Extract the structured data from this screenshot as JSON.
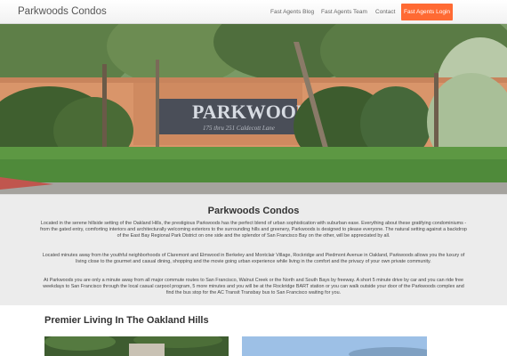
{
  "navbar": {
    "brand": "Parkwoods Condos",
    "links": [
      "Fast Agents Blog",
      "Fast Agents Team",
      "Contact"
    ],
    "login": "Fast Agents Login"
  },
  "hero": {
    "sign_text": "PARKWOOD",
    "sign_subtext": "175 thru 251 Caldecott Lane"
  },
  "intro": {
    "title": "Parkwoods Condos",
    "paragraph1": "Located in the serene hillside setting of the Oakland Hills, the prestigious Parkwoods has the perfect blend of urban sophistication with suburban ease. Everything about these gratifying condominiums - from the gated entry, comforting interiors and architecturally welcoming exteriors to the surrounding hills and greenery, Parkwoods is designed to please everyone. The natural setting against a backdrop of the East Bay Regional Park District on one side and the splendor of San Francisco Bay on the other, will be appreciated by all.",
    "paragraph2": "Located minutes away from the youthful neighborhoods of Claremont and Elmwood in Berkeley and Montclair Village, Rockridge and Piedmont Avenue in Oakland, Parkwoods allows you the luxury of living close to the gourmet and casual dining, shopping and the movie going urban experience while living in the comfort and the privacy of your own private community.",
    "paragraph3": "At Parkwoods you are only a minute away from all major commute routes to San Francisco, Walnut Creek or the North and South Bays by freeway. A short 5 minute drive by car and you can ride free weekdays to San Francisco through the local casual carpool program, 5 more minutes and you will be at the Rockridge BART station or you can walk outside your door of the Parkwoods complex and find the bus stop for the AC Transit Transbay bus to San Francisco waiting for you."
  },
  "section": {
    "title": "Premier Living In The Oakland Hills"
  },
  "colors": {
    "accent": "#ff6a33",
    "intro_bg": "#ececec"
  }
}
